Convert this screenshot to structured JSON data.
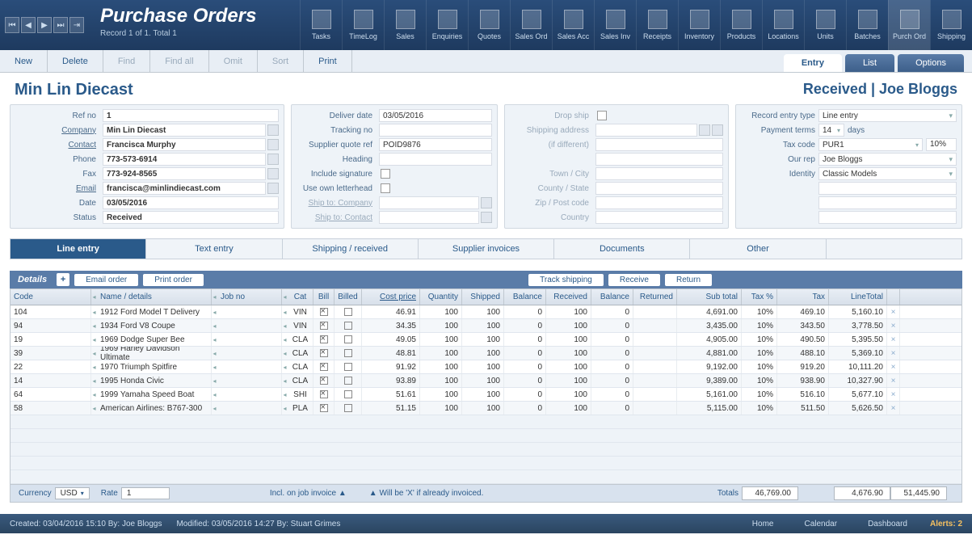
{
  "header": {
    "title": "Purchase Orders",
    "record_info": "Record 1 of 1. Total 1",
    "top_icons": [
      "Tasks",
      "TimeLog",
      "Sales",
      "Enquiries",
      "Quotes",
      "Sales Ord",
      "Sales Acc",
      "Sales Inv",
      "Receipts",
      "Inventory",
      "Products",
      "Locations",
      "Units",
      "Batches",
      "Purch Ord",
      "Shipping"
    ]
  },
  "action_bar": {
    "new": "New",
    "delete": "Delete",
    "find": "Find",
    "findall": "Find all",
    "omit": "Omit",
    "sort": "Sort",
    "print": "Print"
  },
  "right_tabs": {
    "entry": "Entry",
    "list": "List",
    "options": "Options"
  },
  "sub_header": {
    "left": "Min Lin Diecast",
    "right": "Received | Joe Bloggs"
  },
  "p1": {
    "refno_l": "Ref no",
    "refno": "1",
    "company_l": "Company",
    "company": "Min Lin Diecast",
    "contact_l": "Contact",
    "contact": "Francisca Murphy",
    "phone_l": "Phone",
    "phone": "773-573-6914",
    "fax_l": "Fax",
    "fax": "773-924-8565",
    "email_l": "Email",
    "email": "francisca@minlindiecast.com",
    "date_l": "Date",
    "date": "03/05/2016",
    "status_l": "Status",
    "status": "Received"
  },
  "p2": {
    "deliver_l": "Deliver date",
    "deliver": "03/05/2016",
    "track_l": "Tracking no",
    "quote_l": "Supplier quote ref",
    "quote": "POID9876",
    "heading_l": "Heading",
    "sig_l": "Include signature",
    "letter_l": "Use own letterhead",
    "shipco_l": "Ship to: Company",
    "shipct_l": "Ship to: Contact"
  },
  "p3": {
    "drop_l": "Drop ship",
    "shipaddr_l": "Shipping address",
    "diff_l": "(if different)",
    "town_l": "Town / City",
    "county_l": "County / State",
    "zip_l": "Zip / Post code",
    "country_l": "Country"
  },
  "p4": {
    "ret_l": "Record entry type",
    "ret": "Line entry",
    "pay_l": "Payment terms",
    "pay_n": "14",
    "pay_u": "days",
    "tax_l": "Tax code",
    "tax_c": "PUR1",
    "tax_p": "10%",
    "rep_l": "Our rep",
    "rep": "Joe Bloggs",
    "ident_l": "Identity",
    "ident": "Classic Models"
  },
  "sub_tabs": [
    "Line entry",
    "Text entry",
    "Shipping / received",
    "Supplier invoices",
    "Documents",
    "Other",
    ""
  ],
  "details": {
    "label": "Details",
    "email": "Email order",
    "print": "Print order",
    "track": "Track shipping",
    "receive": "Receive",
    "return": "Return"
  },
  "cols": {
    "code": "Code",
    "name": "Name / details",
    "job": "Job no",
    "cat": "Cat",
    "bill": "Bill",
    "billed": "Billed",
    "cost": "Cost price",
    "qty": "Quantity",
    "ship": "Shipped",
    "bal1": "Balance",
    "recv": "Received",
    "bal2": "Balance",
    "ret": "Returned",
    "sub": "Sub total",
    "taxp": "Tax %",
    "tax": "Tax",
    "lt": "LineTotal"
  },
  "rows": [
    {
      "code": "104",
      "name": "1912 Ford Model T Delivery",
      "cat": "VIN",
      "cost": "46.91",
      "qty": "100",
      "ship": "100",
      "bal1": "0",
      "recv": "100",
      "bal2": "0",
      "sub": "4,691.00",
      "taxp": "10%",
      "tax": "469.10",
      "lt": "5,160.10"
    },
    {
      "code": "94",
      "name": "1934 Ford V8 Coupe",
      "cat": "VIN",
      "cost": "34.35",
      "qty": "100",
      "ship": "100",
      "bal1": "0",
      "recv": "100",
      "bal2": "0",
      "sub": "3,435.00",
      "taxp": "10%",
      "tax": "343.50",
      "lt": "3,778.50"
    },
    {
      "code": "19",
      "name": "1969 Dodge Super Bee",
      "cat": "CLA",
      "cost": "49.05",
      "qty": "100",
      "ship": "100",
      "bal1": "0",
      "recv": "100",
      "bal2": "0",
      "sub": "4,905.00",
      "taxp": "10%",
      "tax": "490.50",
      "lt": "5,395.50"
    },
    {
      "code": "39",
      "name": "1969 Harley Davidson Ultimate",
      "cat": "CLA",
      "cost": "48.81",
      "qty": "100",
      "ship": "100",
      "bal1": "0",
      "recv": "100",
      "bal2": "0",
      "sub": "4,881.00",
      "taxp": "10%",
      "tax": "488.10",
      "lt": "5,369.10"
    },
    {
      "code": "22",
      "name": "1970 Triumph Spitfire",
      "cat": "CLA",
      "cost": "91.92",
      "qty": "100",
      "ship": "100",
      "bal1": "0",
      "recv": "100",
      "bal2": "0",
      "sub": "9,192.00",
      "taxp": "10%",
      "tax": "919.20",
      "lt": "10,111.20"
    },
    {
      "code": "14",
      "name": "1995 Honda Civic",
      "cat": "CLA",
      "cost": "93.89",
      "qty": "100",
      "ship": "100",
      "bal1": "0",
      "recv": "100",
      "bal2": "0",
      "sub": "9,389.00",
      "taxp": "10%",
      "tax": "938.90",
      "lt": "10,327.90"
    },
    {
      "code": "64",
      "name": "1999 Yamaha Speed Boat",
      "cat": "SHI",
      "cost": "51.61",
      "qty": "100",
      "ship": "100",
      "bal1": "0",
      "recv": "100",
      "bal2": "0",
      "sub": "5,161.00",
      "taxp": "10%",
      "tax": "516.10",
      "lt": "5,677.10"
    },
    {
      "code": "58",
      "name": "American Airlines: B767-300",
      "cat": "PLA",
      "cost": "51.15",
      "qty": "100",
      "ship": "100",
      "bal1": "0",
      "recv": "100",
      "bal2": "0",
      "sub": "5,115.00",
      "taxp": "10%",
      "tax": "511.50",
      "lt": "5,626.50"
    }
  ],
  "totals": {
    "currency_l": "Currency",
    "currency": "USD",
    "rate_l": "Rate",
    "rate": "1",
    "incl": "Incl. on job invoice ▲",
    "willx": "▲   Will be 'X' if already invoiced.",
    "totals_l": "Totals",
    "sub": "46,769.00",
    "tax": "4,676.90",
    "grand": "51,445.90"
  },
  "footer": {
    "created": "Created: 03/04/2016  15:10   By:  Joe Bloggs",
    "modified": "Modified:  03/05/2016  14:27   By:  Stuart Grimes",
    "home": "Home",
    "cal": "Calendar",
    "dash": "Dashboard",
    "alerts": "Alerts: 2"
  }
}
